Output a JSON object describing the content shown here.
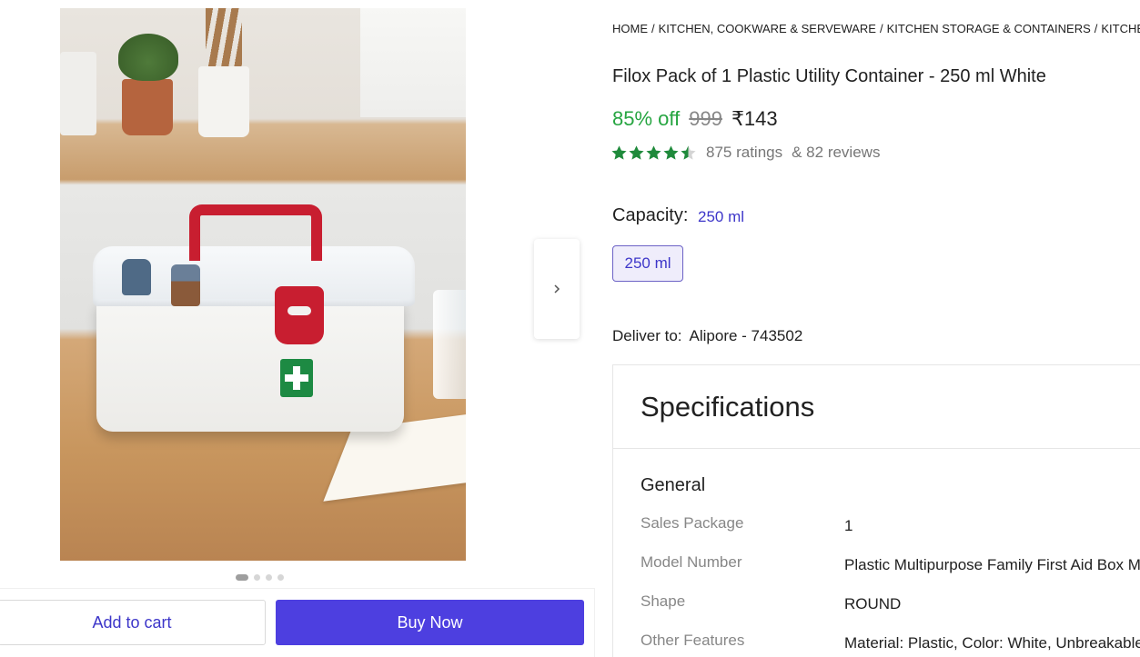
{
  "breadcrumb": [
    "HOME",
    "KITCHEN, COOKWARE & SERVEWARE",
    "KITCHEN STORAGE & CONTAINERS",
    "KITCHEN CONTAINERS"
  ],
  "product": {
    "title": "Filox Pack of 1 Plastic Utility Container  - 250 ml White",
    "discount": "85% off",
    "mrp": "999",
    "price": "₹143",
    "rating_stars": 4.5,
    "ratings": "875 ratings",
    "reviews": "& 82 reviews"
  },
  "capacity": {
    "label": "Capacity:",
    "value": "250 ml",
    "options": [
      "250 ml"
    ]
  },
  "delivery": {
    "label": "Deliver to:",
    "location": "Alipore - 743502"
  },
  "specifications": {
    "heading": "Specifications",
    "group": "General",
    "rows": [
      {
        "key": "Sales Package",
        "value": "1"
      },
      {
        "key": "Model Number",
        "value": "Plastic Multipurpose Family First Aid Box M"
      },
      {
        "key": "Shape",
        "value": "ROUND"
      },
      {
        "key": "Other Features",
        "value": "Material: Plastic, Color: White, Unbreakable"
      }
    ]
  },
  "gallery": {
    "image_count": 4,
    "active_index": 0,
    "image_icon": "first-aid-box-photo",
    "next_icon": "chevron-right-icon"
  },
  "actions": {
    "add_to_cart": "Add to cart",
    "buy_now": "Buy Now"
  },
  "colors": {
    "accent": "#4d3fe0",
    "discount_green": "#26a541",
    "star_green": "#1f8a3b"
  }
}
